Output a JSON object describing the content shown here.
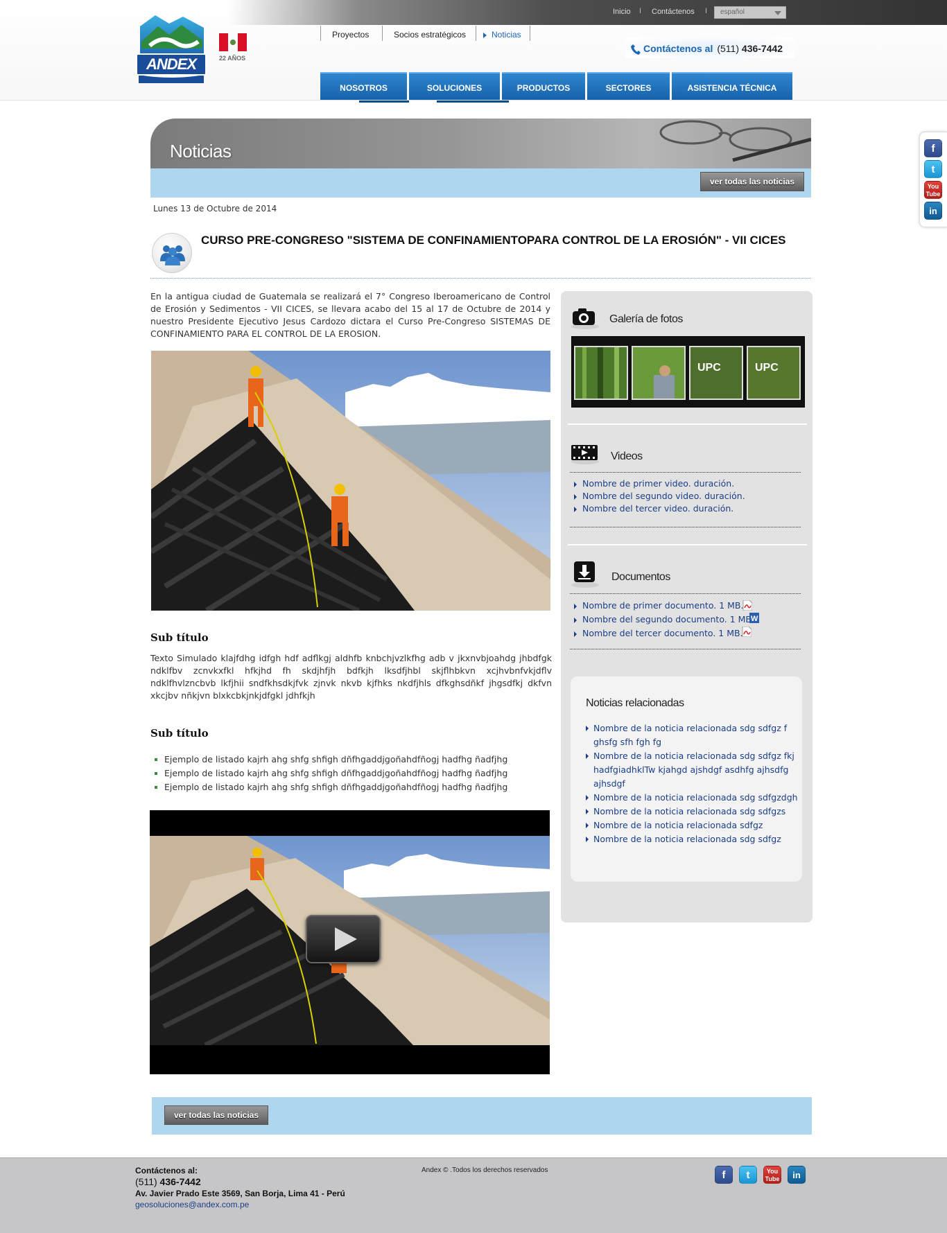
{
  "topbar": {
    "links": [
      "Inicio",
      "Contáctenos"
    ],
    "separator": "I",
    "language": "español"
  },
  "brand": {
    "logo_text": "ANDEX",
    "years": "22 AÑOS"
  },
  "secondary_nav": [
    "Proyectos",
    "Socios estratégicos",
    "Noticias"
  ],
  "contact": {
    "label": "Contáctenos al",
    "prefix": "(511)",
    "number": "436-7442"
  },
  "main_nav": [
    "NOSOTROS",
    "SOLUCIONES",
    "PRODUCTOS",
    "SECTORES",
    "ASISTENCIA TÉCNICA"
  ],
  "social": {
    "facebook": "f",
    "twitter": "t",
    "youtube": "You Tube",
    "linkedin": "in"
  },
  "banner": {
    "title": "Noticias",
    "all_news_button": "ver todas las noticias"
  },
  "article": {
    "date": "Lunes 13 de Octubre de 2014",
    "title": "CURSO PRE-CONGRESO \"SISTEMA DE CONFINAMIENTOPARA CONTROL DE LA EROSIÓN\" - VII CICES",
    "intro": "En la antigua ciudad de Guatemala se realizará el 7° Congreso Iberoamericano de Control de Erosión y Sedimentos - VII CICES, se llevara acabo del 15 al 17 de Octubre de 2014 y nuestro Presidente Ejecutivo Jesus Cardozo dictara el Curso Pre-Congreso SISTEMAS DE CONFINAMIENTO PARA EL CONTROL DE LA EROSION.",
    "subtitle1": "Sub título",
    "body": "Texto Simulado klajfdhg idfgh hdf adflkgj aldhfb knbchjvzlkfhg adb v jkxnvbjoahdg jhbdfgk ndklfbv zcnvkxfkl hfkjhd fh skdjhfjh bdfkjh lksdfjhbl skjflhbkvn xcjhvbnfvkjdflv ndklfhvlzncbvb lkfjhii sndfkhsdkjfvk zjnvk nkvb kjfhks nkdfjhls dfkghsdñkf jhgsdfkj dkfvn xkcjbv nñkjvn blxkcbkjnkjdfgkl jdhfkjh",
    "subtitle2": "Sub título",
    "list": [
      "Ejemplo de listado  kajrh ahg shfg shfigh dñfhgaddjgoñahdfñogj hadfhg ñadfjhg",
      "Ejemplo de listado  kajrh ahg shfg shfigh dñfhgaddjgoñahdfñogj hadfhg ñadfjhg",
      "Ejemplo de listado  kajrh ahg shfg shfigh dñfhgaddjgoñahdfñogj hadfhg ñadfjhg"
    ]
  },
  "sidebar": {
    "gallery_title": "Galería de fotos",
    "videos_title": "Videos",
    "videos": [
      "Nombre de primer video. duración.",
      "Nombre del segundo video. duración.",
      "Nombre del tercer video. duración."
    ],
    "documents_title": "Documentos",
    "documents": [
      {
        "label": "Nombre de primer documento. 1 MB.",
        "icon": "pdf-icon"
      },
      {
        "label": "Nombre del segundo documento. 1 MB.",
        "icon": "word-icon"
      },
      {
        "label": "Nombre del tercer documento. 1 MB..",
        "icon": "pdf-icon"
      }
    ],
    "related_title": "Noticias relacionadas",
    "related": [
      "Nombre de la noticia relacionada sdg sdfgz f ghsfg sfh fgh fg",
      "Nombre de la noticia relacionada sdg sdfgz fkj hadfgiadhklTw kjahgd ajshdgf asdhfg ajhsdfg ajhsdgf",
      "Nombre de la noticia relacionada sdg sdfgzdgh",
      "Nombre de la noticia relacionada sdg sdfgzs",
      "Nombre de la noticia relacionada sdfgz",
      "Nombre de la noticia relacionada sdg sdfgz"
    ]
  },
  "footer": {
    "contact_label": "Contáctenos al:",
    "phone_prefix": "(511)",
    "phone_number": "436-7442",
    "address": "Av. Javier Prado Este 3569, San Borja, Lima 41 - Perú",
    "email": "geosoluciones@andex.com.pe",
    "copyright": "Andex © .Todos los derechos reservados"
  },
  "colors": {
    "nav_blue": "#1a6bb8",
    "light_blue_bar": "#aed6ee",
    "link_blue": "#1a3e86",
    "footer_grey": "#c6c6c8"
  }
}
